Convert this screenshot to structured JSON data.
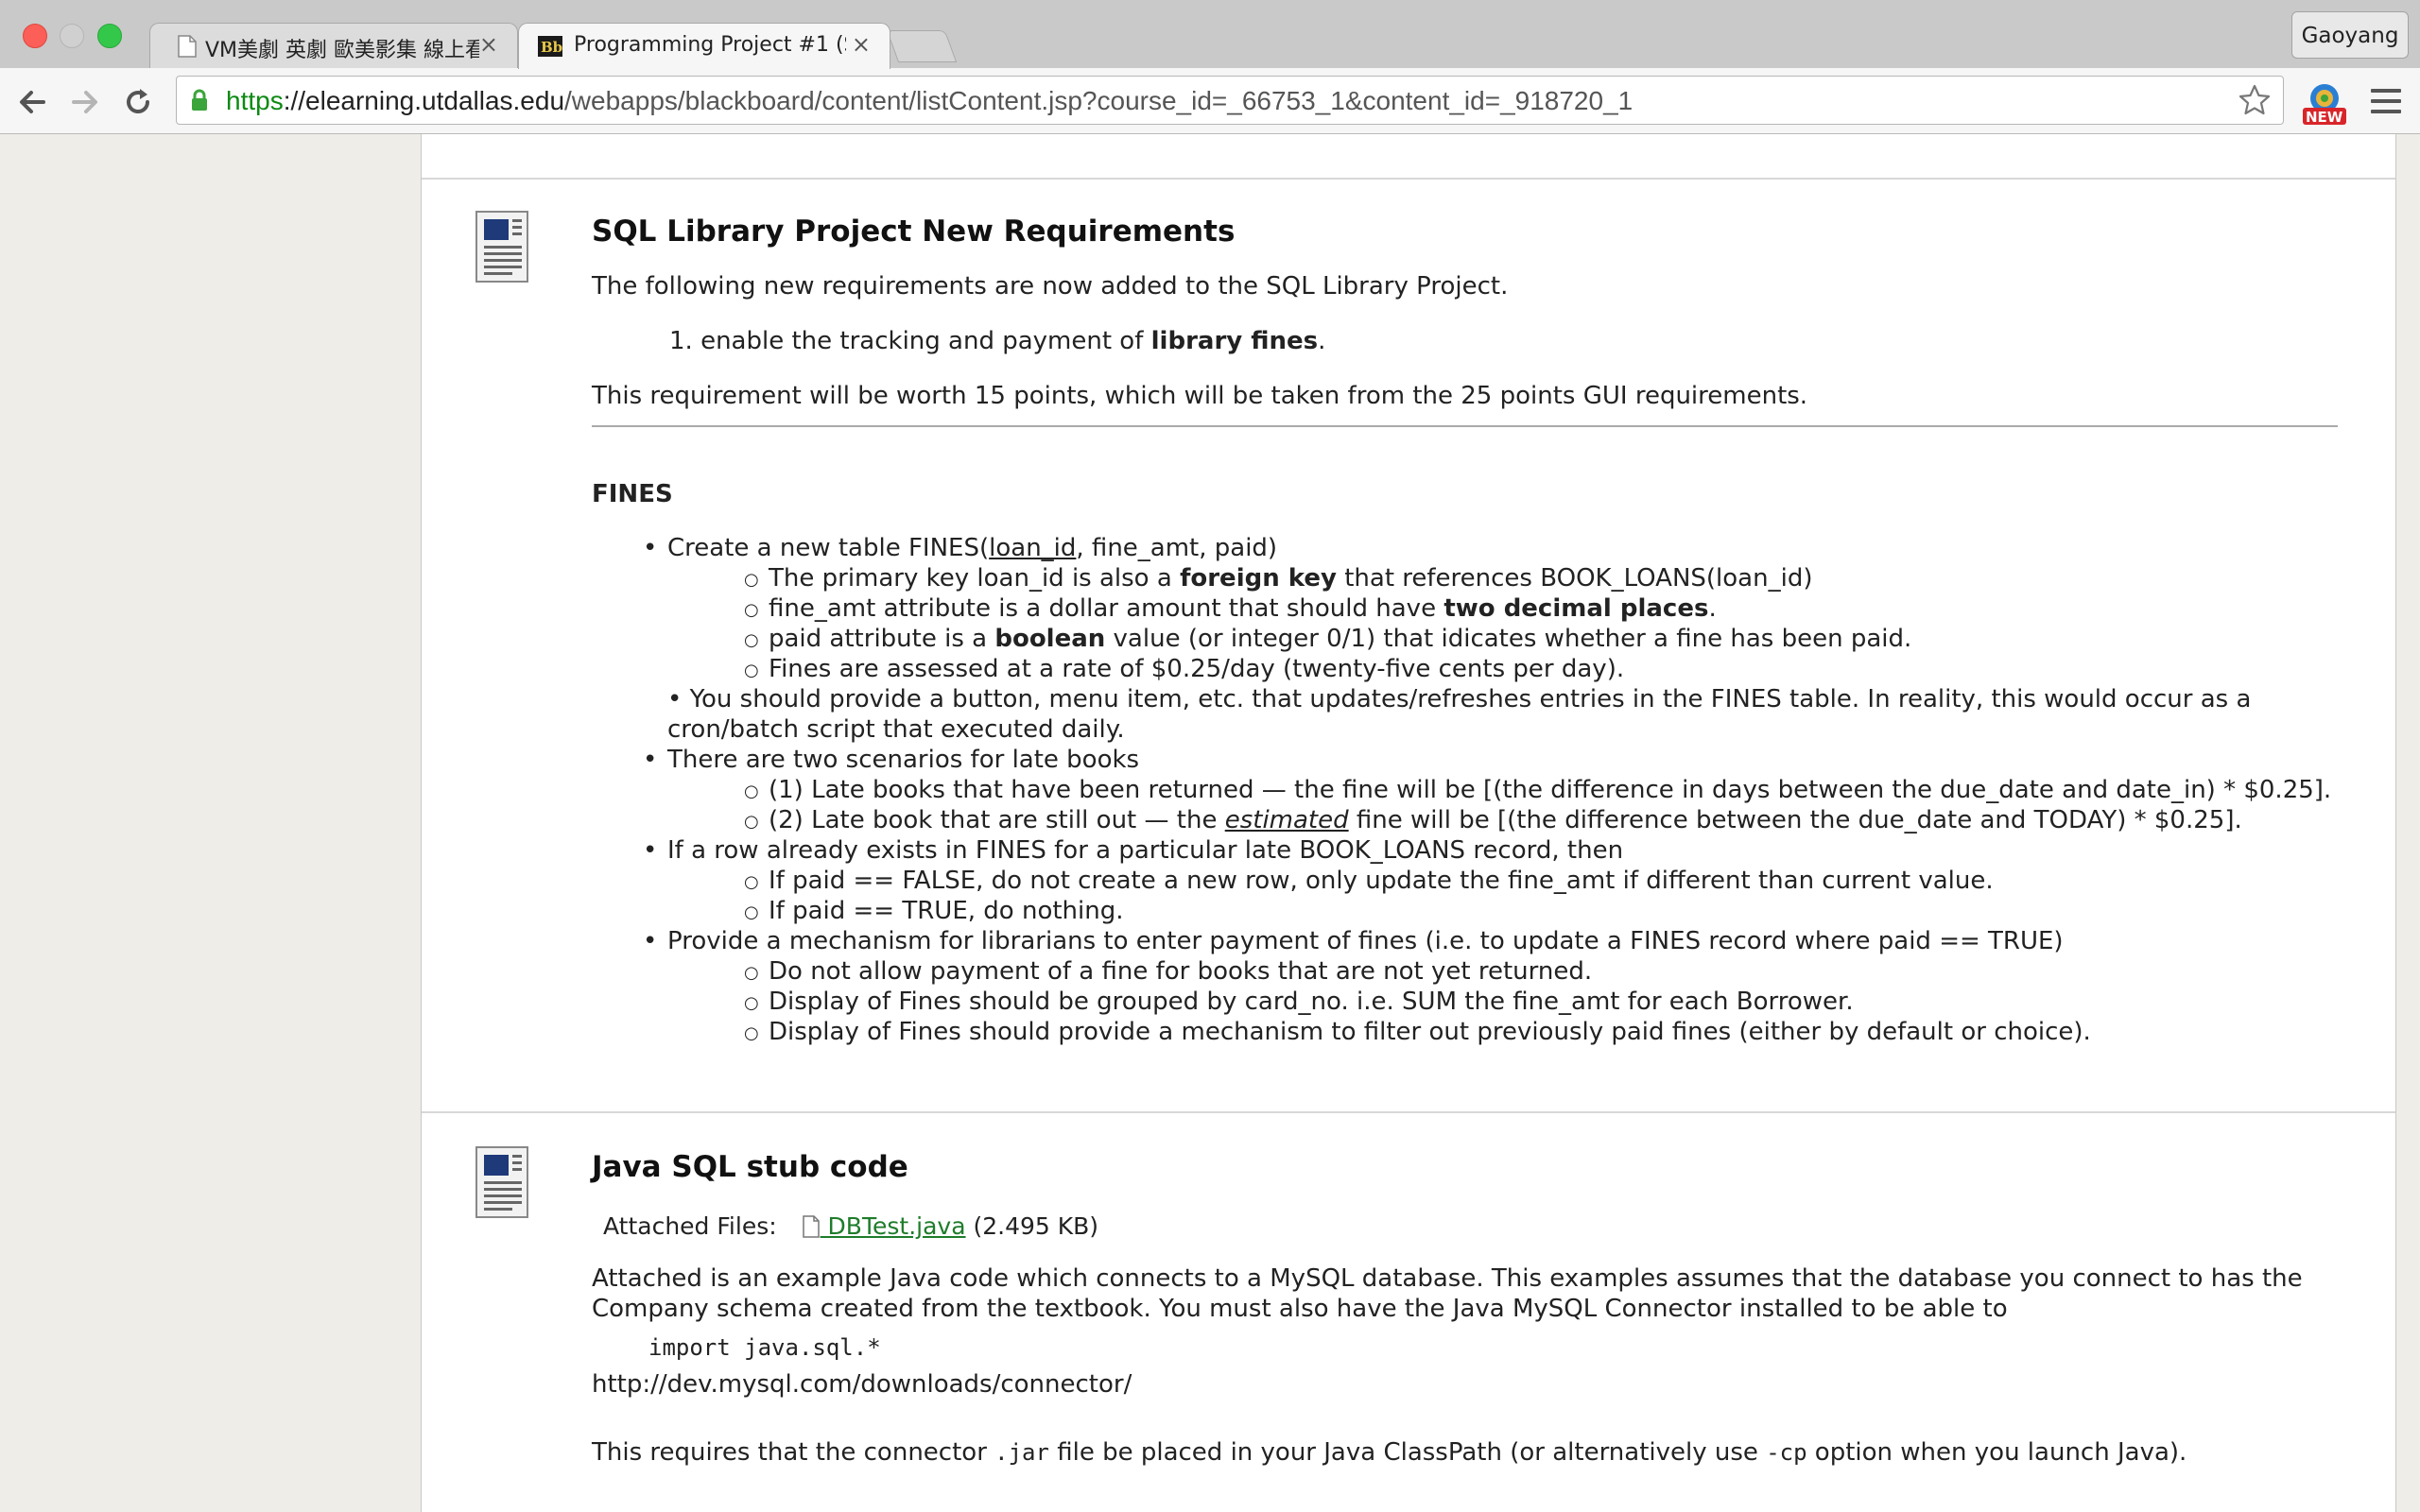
{
  "browser": {
    "tabs": [
      {
        "title": "VM美劇 英劇 歐美影集 線上看",
        "close": "×"
      },
      {
        "title": "Programming Project #1 (S",
        "close": "×"
      }
    ],
    "profile_name": "Gaoyang",
    "url": {
      "scheme": "https",
      "host": "://elearning.utdallas.edu",
      "path": "/webapps/blackboard/content/listContent.jsp?course_id=_66753_1&content_id=_918720_1"
    },
    "icons": [
      "back-icon",
      "forward-icon",
      "reload-icon",
      "lock-icon",
      "star-icon",
      "new-extension-icon",
      "menu-icon"
    ]
  },
  "items": [
    {
      "title": "SQL Library Project New Requirements",
      "intro": "The following new requirements are now added to the SQL Library Project.",
      "ordered": {
        "prefix": "1. enable the tracking and payment of ",
        "bold": "library fines",
        "suffix": "."
      },
      "points_note": "This requirement will be worth 15 points, which will be taken from the 25 points GUI requirements.",
      "heading": "FINES",
      "bullets": {
        "b1": {
          "a": "Create a new table FINES(",
          "u": "loan_id",
          "b": ", fine_amt, paid)"
        },
        "b1_1": {
          "a": "The primary key loan_id is also a ",
          "bold": "foreign key",
          "b": " that references BOOK_LOANS(loan_id)"
        },
        "b1_2": {
          "a": "fine_amt attribute is a dollar amount that should have ",
          "bold": "two decimal places",
          "b": "."
        },
        "b1_3": {
          "a": "paid attribute is a ",
          "bold": "boolean",
          "b": " value (or integer 0/1) that idicates whether a fine has been paid."
        },
        "b1_4": "Fines are assessed at a rate of $0.25/day (twenty-five cents per day).",
        "b2_line1": "• You should provide a button, menu item, etc. that updates/refreshes entries in the FINES table. In reality, this would occur as a",
        "b2_line2": "cron/batch script that executed daily.",
        "b3": "There are two scenarios for late books",
        "b3_1": "(1) Late books that have been returned — the fine will be [(the difference in days between the due_date and date_in) * $0.25].",
        "b3_2": {
          "a": "(2) Late book that are still out — the ",
          "em": "estimated",
          "b": " fine will be [(the difference between the due_date and TODAY) * $0.25]."
        },
        "b4": "If a row already exists in FINES for a particular late BOOK_LOANS record, then",
        "b4_1": "If paid == FALSE, do not create a new row, only update the fine_amt if different than current value.",
        "b4_2": "If paid == TRUE, do nothing.",
        "b5": "Provide a mechanism for librarians to enter payment of fines (i.e. to update a FINES record where paid == TRUE)",
        "b5_1": "Do not allow payment of a fine for books that are not yet returned.",
        "b5_2": "Display of Fines should be grouped by card_no. i.e. SUM the fine_amt for each Borrower.",
        "b5_3": "Display of Fines should provide a mechanism to filter out previously paid fines (either by default or choice)."
      }
    },
    {
      "title": "Java SQL stub code",
      "attached_label": "Attached Files:",
      "file_name": " DBTest.java",
      "file_size": "(2.495 KB)",
      "para1_line1": "Attached is an example Java code which connects to a MySQL database. This examples assumes that the database you connect to has the",
      "para1_line2": "Company schema created from the textbook. You must also have the Java MySQL Connector installed to be able to",
      "code": "import java.sql.*",
      "connector_url": "http://dev.mysql.com/downloads/connector/",
      "para2": {
        "a": "This requires that the connector ",
        "code1": ".jar",
        "b": " file be placed in your Java ClassPath (or alternatively use ",
        "code2": "-cp",
        "c": " option when you launch Java)."
      }
    }
  ]
}
